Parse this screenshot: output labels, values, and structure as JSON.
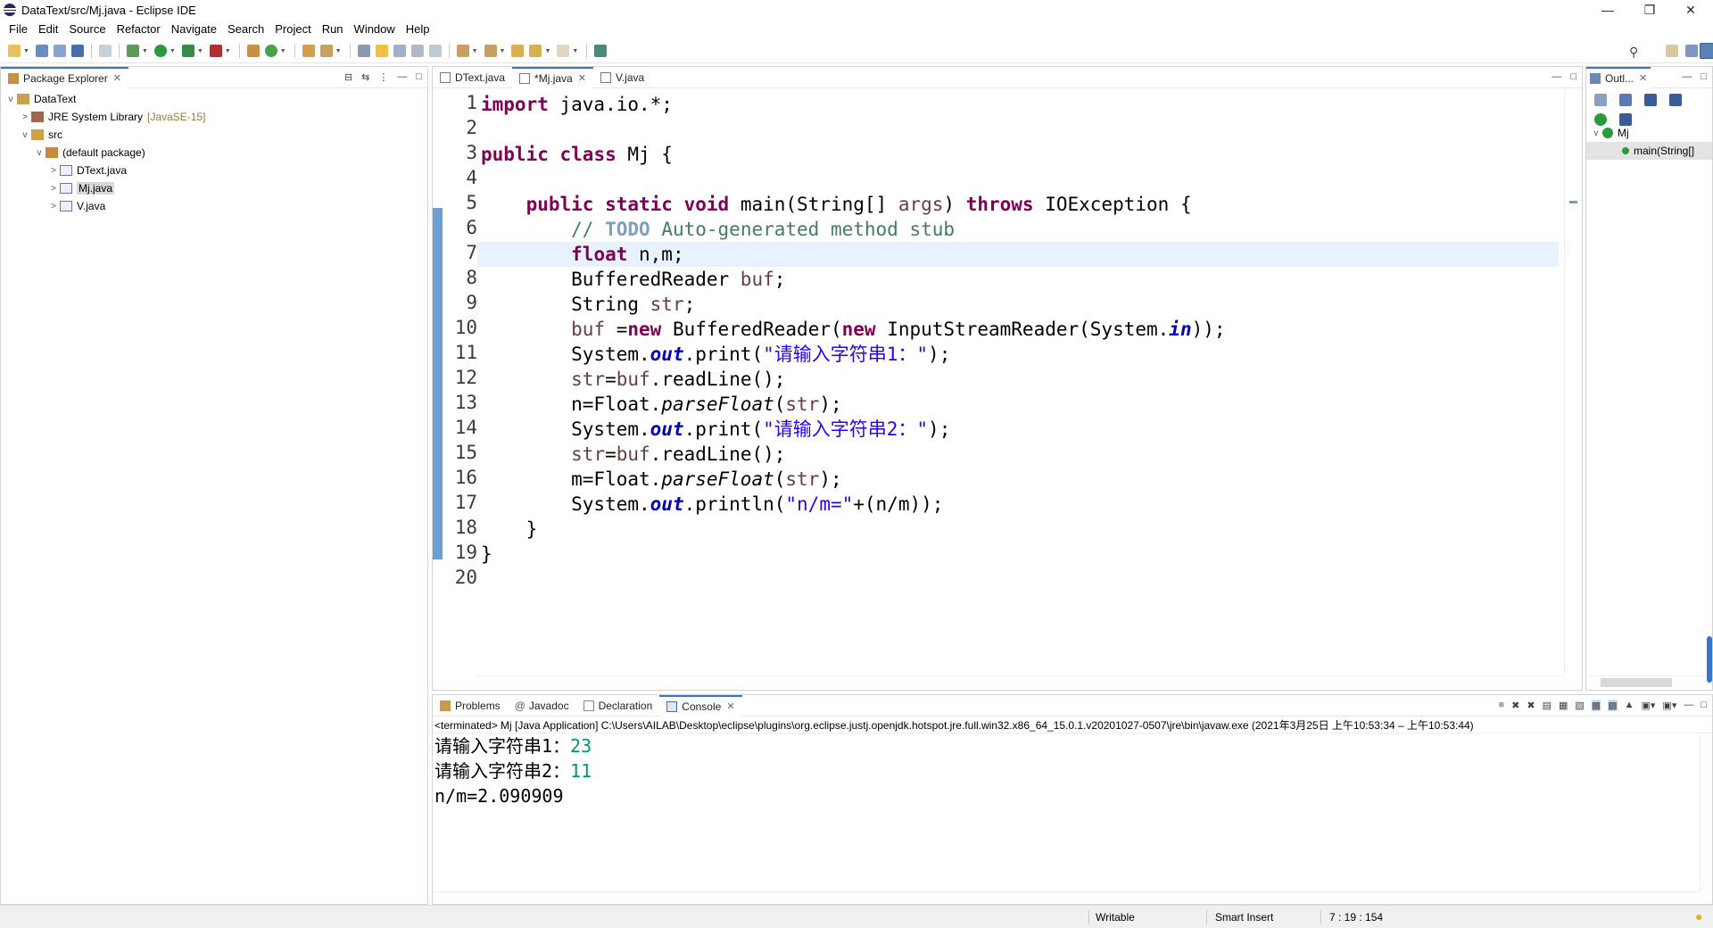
{
  "window": {
    "title": "DataText/src/Mj.java - Eclipse IDE"
  },
  "menu": [
    "File",
    "Edit",
    "Source",
    "Refactor",
    "Navigate",
    "Search",
    "Project",
    "Run",
    "Window",
    "Help"
  ],
  "package_explorer": {
    "title": "Package Explorer",
    "tree": [
      {
        "label": "DataText",
        "icon": "project-icon",
        "twist": "v"
      },
      {
        "label": "JRE System Library",
        "decoration": "[JavaSE-15]",
        "icon": "library-icon",
        "twist": ">"
      },
      {
        "label": "src",
        "icon": "source-folder-icon",
        "twist": "v"
      },
      {
        "label": "(default package)",
        "icon": "package-icon",
        "twist": "v"
      },
      {
        "label": "DText.java",
        "icon": "java-file-icon",
        "twist": ">"
      },
      {
        "label": "Mj.java",
        "icon": "java-file-icon",
        "twist": ">",
        "selected": true
      },
      {
        "label": "V.java",
        "icon": "java-file-icon",
        "twist": ">"
      }
    ]
  },
  "editor": {
    "tabs": [
      {
        "label": "DText.java"
      },
      {
        "label": "*Mj.java",
        "active": true
      },
      {
        "label": "V.java"
      }
    ],
    "line_numbers": [
      "1",
      "2",
      "3",
      "4",
      "5",
      "6",
      "7",
      "8",
      "9",
      "10",
      "11",
      "12",
      "13",
      "14",
      "15",
      "16",
      "17",
      "18",
      "19",
      "20"
    ],
    "code": [
      "import java.io.*;",
      "",
      "public class Mj {",
      "",
      "    public static void main(String[] args) throws IOException {",
      "        // TODO Auto-generated method stub",
      "        float n,m;",
      "        BufferedReader buf;",
      "        String str;",
      "        buf =new BufferedReader(new InputStreamReader(System.in));",
      "        System.out.print(\"请输入字符串1：\");",
      "        str=buf.readLine();",
      "        n=Float.parseFloat(str);",
      "        System.out.print(\"请输入字符串2：\");",
      "        str=buf.readLine();",
      "        m=Float.parseFloat(str);",
      "        System.out.println(\"n/m=\"+(n/m));",
      "    }",
      "}",
      ""
    ]
  },
  "outline": {
    "title": "Outl...",
    "class_name": "Mj",
    "method": "main(String[]"
  },
  "console": {
    "tabs": [
      "Problems",
      "Javadoc",
      "Declaration",
      "Console"
    ],
    "info": "<terminated> Mj [Java Application] C:\\Users\\AILAB\\Desktop\\eclipse\\plugins\\org.eclipse.justj.openjdk.hotspot.jre.full.win32.x86_64_15.0.1.v20201027-0507\\jre\\bin\\javaw.exe  (2021年3月25日 上午10:53:34 – 上午10:53:44)",
    "lines": [
      {
        "prompt": "请输入字符串1：",
        "input": "23"
      },
      {
        "prompt": "请输入字符串2：",
        "input": "11"
      },
      {
        "prompt": "n/m=2.090909",
        "input": ""
      }
    ]
  },
  "statusbar": {
    "mode": "Writable",
    "insert": "Smart Insert",
    "position": "7 : 19 : 154"
  }
}
